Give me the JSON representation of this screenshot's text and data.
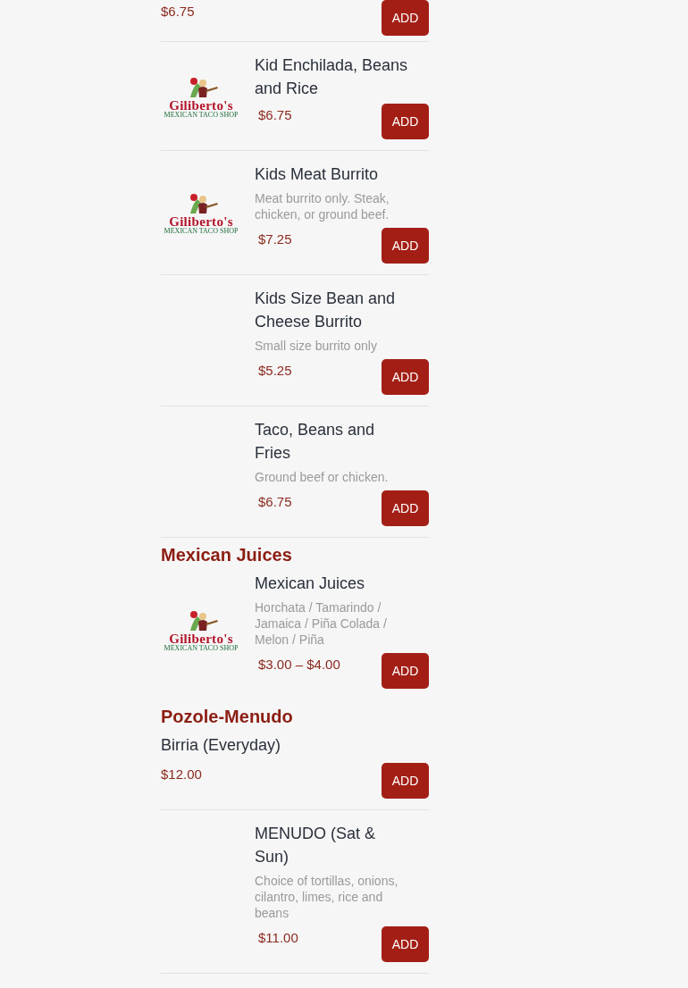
{
  "sections": [
    {
      "items": [
        {
          "kind": "none",
          "price": "$6.75",
          "button": "ADD"
        }
      ]
    },
    {
      "items": [
        {
          "kind": "logo",
          "logo": {
            "name": "Giliberto's",
            "tagline": "MEXICAN TACO SHOP"
          },
          "name": "Kid Enchilada, Beans and Rice",
          "price": "$6.75",
          "button": "ADD"
        },
        {
          "kind": "logo",
          "logo": {
            "name": "Giliberto's",
            "tagline": "MEXICAN TACO SHOP"
          },
          "name": "Kids Meat Burrito",
          "description": "Meat burrito only. Steak, chicken, or ground beef.",
          "price": "$7.25",
          "button": "ADD"
        },
        {
          "kind": "empty",
          "name": "Kids Size Bean and Cheese Burrito",
          "description": "Small size burrito only",
          "price": "$5.25",
          "button": "ADD"
        },
        {
          "kind": "empty",
          "name": "Taco, Beans and Fries",
          "description": "Ground beef or chicken.",
          "price": "$6.75",
          "button": "ADD"
        }
      ]
    },
    {
      "heading": "Mexican Juices",
      "items": [
        {
          "kind": "logo",
          "logo": {
            "name": "Giliberto's",
            "tagline": "MEXICAN TACO SHOP"
          },
          "name": "Mexican Juices",
          "description": "Horchata / Tamarindo / Jamaica / Piña Colada / Melon / Piña",
          "price": "$3.00 – $4.00",
          "button": "ADD"
        }
      ]
    },
    {
      "heading": "Pozole-Menudo",
      "items": [
        {
          "kind": "none",
          "name": "Birria (Everyday)",
          "price": "$12.00",
          "button": "ADD"
        },
        {
          "kind": "empty",
          "name": "MENUDO (Sat & Sun)",
          "description": "Choice of tortillas, onions, cilantro, limes, rice and beans",
          "price": "$11.00",
          "button": "ADD"
        }
      ]
    }
  ]
}
